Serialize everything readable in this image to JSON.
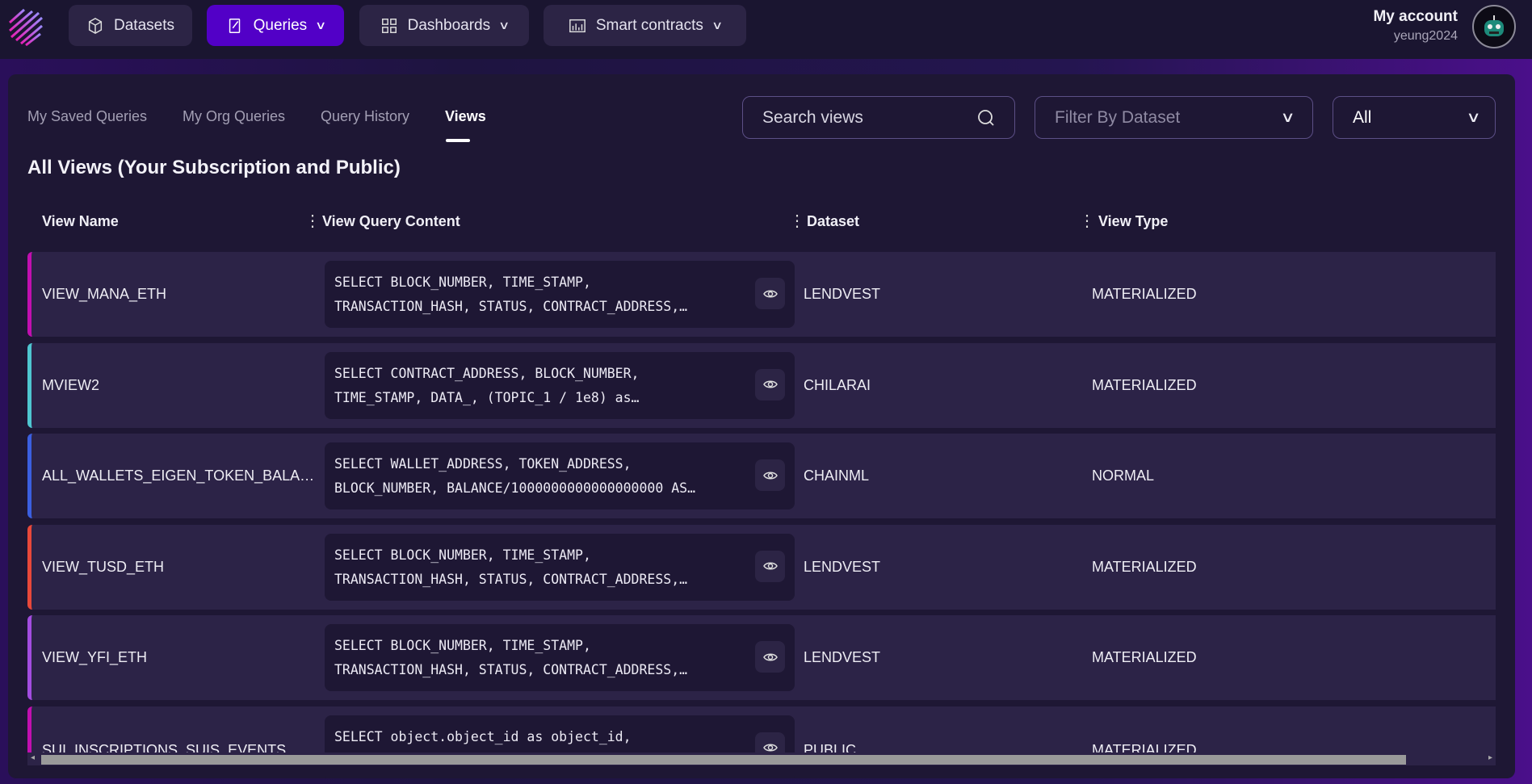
{
  "nav": {
    "items": [
      {
        "label": "Datasets",
        "icon": "cube-icon"
      },
      {
        "label": "Queries",
        "icon": "edit-icon",
        "active": true
      },
      {
        "label": "Dashboards",
        "icon": "grid-icon"
      },
      {
        "label": "Smart contracts",
        "icon": "chart-icon"
      }
    ],
    "account_label": "My account",
    "username": "yeung2024"
  },
  "tabs": [
    "My Saved Queries",
    "My Org Queries",
    "Query History",
    "Views"
  ],
  "active_tab": "Views",
  "search": {
    "placeholder": "Search views"
  },
  "dataset_filter": {
    "placeholder": "Filter By Dataset"
  },
  "type_filter": {
    "value": "All"
  },
  "section_title": "All Views (Your Subscription and Public)",
  "columns": [
    "View Name",
    "View Query Content",
    "Dataset",
    "View Type"
  ],
  "rows": [
    {
      "name": "VIEW_MANA_ETH",
      "query": "SELECT BLOCK_NUMBER, TIME_STAMP,\nTRANSACTION_HASH, STATUS, CONTRACT_ADDRESS,…",
      "dataset": "LENDVEST",
      "type": "MATERIALIZED",
      "color": "#c10fb0"
    },
    {
      "name": "MVIEW2",
      "query": "SELECT CONTRACT_ADDRESS, BLOCK_NUMBER,\nTIME_STAMP, DATA_, (TOPIC_1 / 1e8) as…",
      "dataset": "CHILARAI",
      "type": "MATERIALIZED",
      "color": "#4fc6d0"
    },
    {
      "name": "ALL_WALLETS_EIGEN_TOKEN_BALA…",
      "query": "SELECT WALLET_ADDRESS, TOKEN_ADDRESS,\nBLOCK_NUMBER, BALANCE/1000000000000000000 AS…",
      "dataset": "CHAINML",
      "type": "NORMAL",
      "color": "#3b5fe0"
    },
    {
      "name": "VIEW_TUSD_ETH",
      "query": "SELECT BLOCK_NUMBER, TIME_STAMP,\nTRANSACTION_HASH, STATUS, CONTRACT_ADDRESS,…",
      "dataset": "LENDVEST",
      "type": "MATERIALIZED",
      "color": "#e8483a"
    },
    {
      "name": "VIEW_YFI_ETH",
      "query": "SELECT BLOCK_NUMBER, TIME_STAMP,\nTRANSACTION_HASH, STATUS, CONTRACT_ADDRESS,…",
      "dataset": "LENDVEST",
      "type": "MATERIALIZED",
      "color": "#a34de0"
    },
    {
      "name": "SUI_INSCRIPTIONS_SUIS_EVENTS",
      "query": "SELECT object.object_id as object_id,",
      "dataset": "PUBLIC",
      "type": "MATERIALIZED",
      "color": "#c10fb0"
    }
  ]
}
